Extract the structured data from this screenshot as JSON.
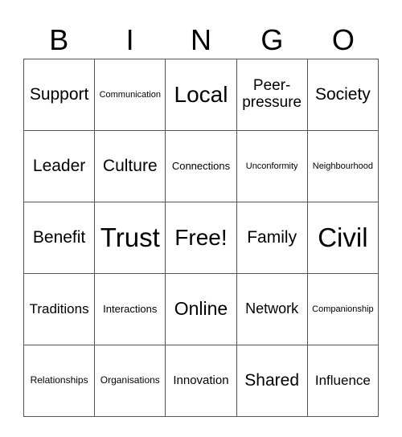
{
  "header": {
    "letters": [
      "B",
      "I",
      "N",
      "G",
      "O"
    ]
  },
  "cells": [
    [
      "Support",
      "Communication",
      "Local",
      "Peer-pressure",
      "Society"
    ],
    [
      "Leader",
      "Culture",
      "Connections",
      "Unconformity",
      "Neighbourhood"
    ],
    [
      "Benefit",
      "Trust",
      "Free!",
      "Family",
      "Civil"
    ],
    [
      "Traditions",
      "Interactions",
      "Online",
      "Network",
      "Companionship"
    ],
    [
      "Relationships",
      "Organisations",
      "Innovation",
      "Shared",
      "Influence"
    ]
  ]
}
